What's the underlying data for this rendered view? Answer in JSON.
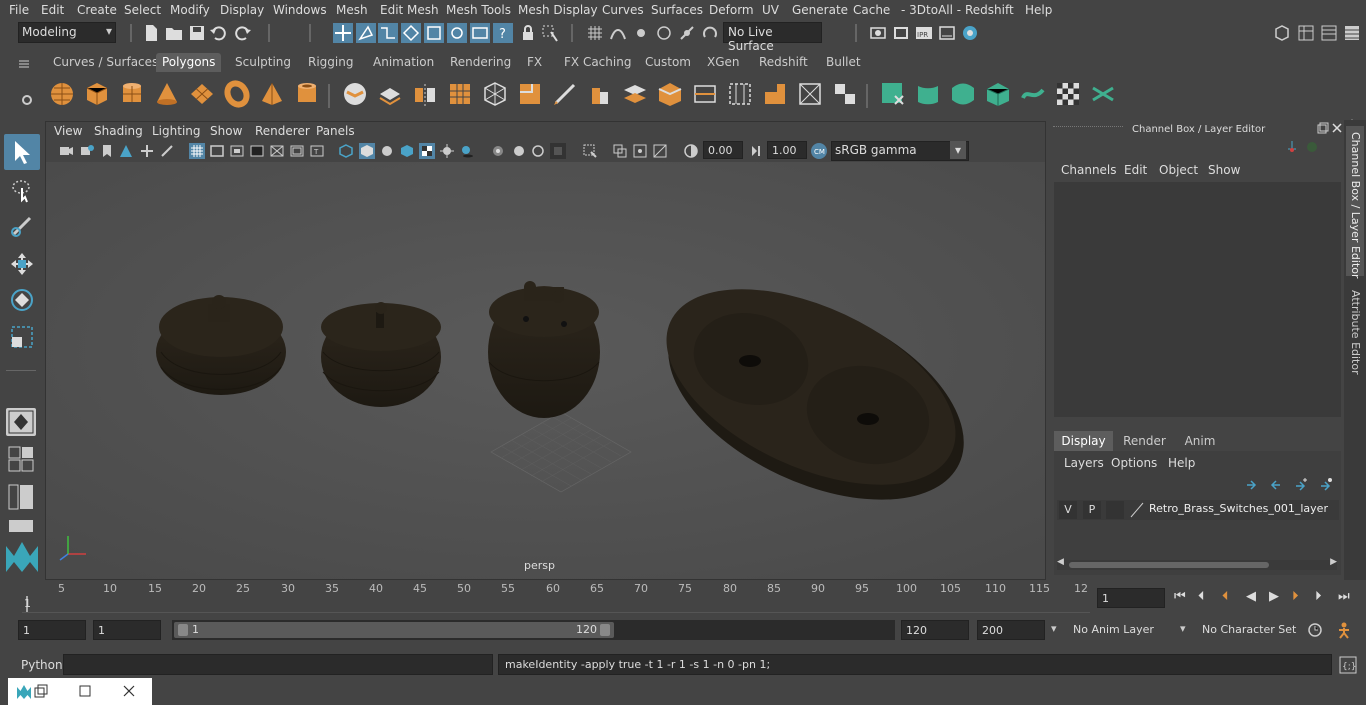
{
  "menubar": {
    "items": [
      "File",
      "Edit",
      "Create",
      "Select",
      "Modify",
      "Display",
      "Windows",
      "Mesh",
      "Edit Mesh",
      "Mesh Tools",
      "Mesh Display",
      "Curves",
      "Surfaces",
      "Deform",
      "UV",
      "Generate",
      "Cache",
      "- 3DtoAll -",
      "Redshift",
      "Help"
    ]
  },
  "statusline": {
    "workspace": "Modeling",
    "live_surface": "No Live Surface"
  },
  "shelf": {
    "tabs": [
      "Curves / Surfaces",
      "Polygons",
      "Sculpting",
      "Rigging",
      "Animation",
      "Rendering",
      "FX",
      "FX Caching",
      "Custom",
      "XGen",
      "Redshift",
      "Bullet"
    ],
    "active_tab": "Polygons"
  },
  "viewport": {
    "menu": [
      "View",
      "Shading",
      "Lighting",
      "Show",
      "Renderer",
      "Panels"
    ],
    "exposure": "0.00",
    "gamma": "1.00",
    "color_space": "sRGB gamma",
    "camera_label": "persp"
  },
  "channelbox": {
    "title": "Channel Box / Layer Editor",
    "menu": [
      "Channels",
      "Edit",
      "Object",
      "Show"
    ],
    "layer_tabs": [
      "Display",
      "Render",
      "Anim"
    ],
    "active_layer_tab": "Display",
    "layer_menu": [
      "Layers",
      "Options",
      "Help"
    ],
    "layer": {
      "v": "V",
      "p": "P",
      "name": "Retro_Brass_Switches_001_layer"
    }
  },
  "sidetabs": [
    "Channel Box / Layer Editor",
    "Attribute Editor"
  ],
  "timeline": {
    "ticks": [
      "5",
      "10",
      "15",
      "20",
      "25",
      "30",
      "35",
      "40",
      "45",
      "50",
      "55",
      "60",
      "65",
      "70",
      "75",
      "80",
      "85",
      "90",
      "95",
      "100",
      "105",
      "110",
      "115",
      "12"
    ],
    "start_marker": "1",
    "current_frame": "1"
  },
  "range": {
    "start": "1",
    "playback_start": "1",
    "slider_start": "1",
    "slider_end": "120",
    "playback_end": "120",
    "end": "200",
    "anim_layer": "No Anim Layer",
    "character_set": "No Character Set"
  },
  "cmdline": {
    "language": "Python",
    "result": "makeIdentity -apply true -t 1 -r 1 -s 1 -n 0 -pn 1;"
  },
  "colors": {
    "bg": "#444444",
    "field": "#2b2b2b",
    "shelf_orange": "#e0913d",
    "shelf_teal": "#3fb08f",
    "active_blue": "#5285a6",
    "object": "#2a241b"
  }
}
